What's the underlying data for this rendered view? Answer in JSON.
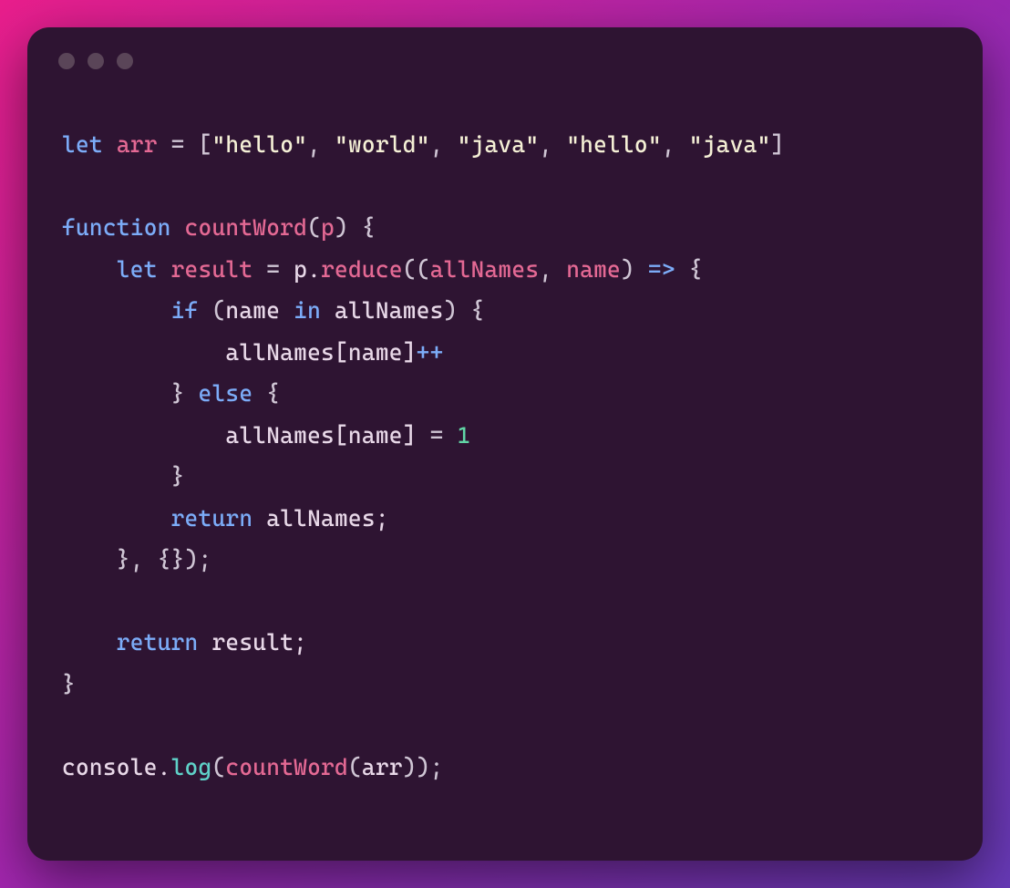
{
  "code": {
    "tokens": [
      [
        {
          "cls": "tok-keyword",
          "t": "let"
        },
        {
          "cls": "tok-plain",
          "t": " "
        },
        {
          "cls": "tok-ident-red",
          "t": "arr"
        },
        {
          "cls": "tok-plain",
          "t": " "
        },
        {
          "cls": "tok-op",
          "t": "="
        },
        {
          "cls": "tok-plain",
          "t": " "
        },
        {
          "cls": "tok-punct",
          "t": "["
        },
        {
          "cls": "tok-string",
          "t": "\"hello\""
        },
        {
          "cls": "tok-punct",
          "t": ", "
        },
        {
          "cls": "tok-string",
          "t": "\"world\""
        },
        {
          "cls": "tok-punct",
          "t": ", "
        },
        {
          "cls": "tok-string",
          "t": "\"java\""
        },
        {
          "cls": "tok-punct",
          "t": ", "
        },
        {
          "cls": "tok-string",
          "t": "\"hello\""
        },
        {
          "cls": "tok-punct",
          "t": ", "
        },
        {
          "cls": "tok-string",
          "t": "\"java\""
        },
        {
          "cls": "tok-punct",
          "t": "]"
        }
      ],
      [],
      [
        {
          "cls": "tok-keyword",
          "t": "function"
        },
        {
          "cls": "tok-plain",
          "t": " "
        },
        {
          "cls": "tok-func",
          "t": "countWord"
        },
        {
          "cls": "tok-punct",
          "t": "("
        },
        {
          "cls": "tok-ident-red",
          "t": "p"
        },
        {
          "cls": "tok-punct",
          "t": ") {"
        }
      ],
      [
        {
          "cls": "tok-plain",
          "t": "    "
        },
        {
          "cls": "tok-keyword",
          "t": "let"
        },
        {
          "cls": "tok-plain",
          "t": " "
        },
        {
          "cls": "tok-ident-red",
          "t": "result"
        },
        {
          "cls": "tok-plain",
          "t": " "
        },
        {
          "cls": "tok-op",
          "t": "="
        },
        {
          "cls": "tok-plain",
          "t": " p."
        },
        {
          "cls": "tok-func",
          "t": "reduce"
        },
        {
          "cls": "tok-punct",
          "t": "(("
        },
        {
          "cls": "tok-ident-red",
          "t": "allNames"
        },
        {
          "cls": "tok-punct",
          "t": ", "
        },
        {
          "cls": "tok-ident-red",
          "t": "name"
        },
        {
          "cls": "tok-punct",
          "t": ") "
        },
        {
          "cls": "tok-arrow",
          "t": "=>"
        },
        {
          "cls": "tok-punct",
          "t": " {"
        }
      ],
      [
        {
          "cls": "tok-plain",
          "t": "        "
        },
        {
          "cls": "tok-keyword",
          "t": "if"
        },
        {
          "cls": "tok-plain",
          "t": " "
        },
        {
          "cls": "tok-punct",
          "t": "("
        },
        {
          "cls": "tok-plain",
          "t": "name "
        },
        {
          "cls": "tok-keyword",
          "t": "in"
        },
        {
          "cls": "tok-plain",
          "t": " allNames"
        },
        {
          "cls": "tok-punct",
          "t": ") {"
        }
      ],
      [
        {
          "cls": "tok-plain",
          "t": "            allNames[name]"
        },
        {
          "cls": "tok-arrow",
          "t": "++"
        }
      ],
      [
        {
          "cls": "tok-plain",
          "t": "        "
        },
        {
          "cls": "tok-punct",
          "t": "} "
        },
        {
          "cls": "tok-keyword",
          "t": "else"
        },
        {
          "cls": "tok-punct",
          "t": " {"
        }
      ],
      [
        {
          "cls": "tok-plain",
          "t": "            allNames[name] "
        },
        {
          "cls": "tok-op",
          "t": "="
        },
        {
          "cls": "tok-plain",
          "t": " "
        },
        {
          "cls": "tok-number",
          "t": "1"
        }
      ],
      [
        {
          "cls": "tok-plain",
          "t": "        "
        },
        {
          "cls": "tok-punct",
          "t": "}"
        }
      ],
      [
        {
          "cls": "tok-plain",
          "t": "        "
        },
        {
          "cls": "tok-keyword",
          "t": "return"
        },
        {
          "cls": "tok-plain",
          "t": " allNames;"
        }
      ],
      [
        {
          "cls": "tok-plain",
          "t": "    "
        },
        {
          "cls": "tok-punct",
          "t": "}, {});"
        }
      ],
      [],
      [
        {
          "cls": "tok-plain",
          "t": "    "
        },
        {
          "cls": "tok-keyword",
          "t": "return"
        },
        {
          "cls": "tok-plain",
          "t": " result;"
        }
      ],
      [
        {
          "cls": "tok-punct",
          "t": "}"
        }
      ],
      [],
      [
        {
          "cls": "tok-plain",
          "t": "console."
        },
        {
          "cls": "tok-method",
          "t": "log"
        },
        {
          "cls": "tok-punct",
          "t": "("
        },
        {
          "cls": "tok-func",
          "t": "countWord"
        },
        {
          "cls": "tok-punct",
          "t": "("
        },
        {
          "cls": "tok-plain",
          "t": "arr"
        },
        {
          "cls": "tok-punct",
          "t": "));"
        }
      ]
    ]
  }
}
